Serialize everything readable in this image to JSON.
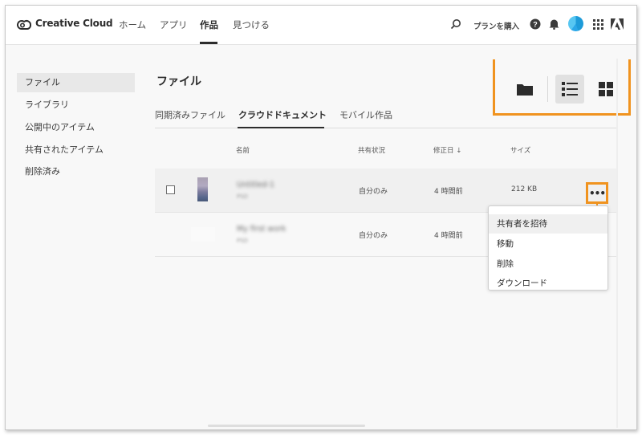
{
  "app": {
    "brand": "Creative Cloud"
  },
  "nav": {
    "items": [
      "ホーム",
      "アプリ",
      "作品",
      "見つける"
    ],
    "active": "作品"
  },
  "header": {
    "buy_plan": "プランを購入",
    "icons": [
      "search-icon",
      "help-icon",
      "bell-icon",
      "avatar",
      "apps-grid-icon",
      "adobe-logo-icon"
    ]
  },
  "sidebar": {
    "items": [
      {
        "label": "ファイル",
        "active": true
      },
      {
        "label": "ライブラリ",
        "active": false
      },
      {
        "label": "公開中のアイテム",
        "active": false
      },
      {
        "label": "共有されたアイテム",
        "active": false
      },
      {
        "label": "削除済み",
        "active": false
      }
    ]
  },
  "main": {
    "title": "ファイル",
    "tabs": [
      {
        "label": "同期済みファイル",
        "active": false
      },
      {
        "label": "クラウドドキュメント",
        "active": true
      },
      {
        "label": "モバイル作品",
        "active": false
      }
    ],
    "view_buttons": [
      "folder-icon",
      "list-view-icon",
      "grid-view-icon"
    ],
    "selected_view": "list-view-icon",
    "columns": {
      "name": "名前",
      "shared": "共有状況",
      "modified": "修正日",
      "size": "サイズ"
    },
    "rows": [
      {
        "name": "Untitled-1",
        "sub": "PSD",
        "shared": "自分のみ",
        "modified": "4 時間前",
        "size": "212 KB"
      },
      {
        "name": "My first work",
        "sub": "PSD",
        "shared": "自分のみ",
        "modified": "4 時間前",
        "size": ""
      }
    ],
    "more_button": "•••"
  },
  "context_menu": {
    "items": [
      "共有者を招待",
      "移動",
      "削除",
      "ダウンロード"
    ]
  },
  "colors": {
    "highlight": "#f0931f",
    "text": "#2c2c2c",
    "selected_bg": "#e1e1e1"
  }
}
